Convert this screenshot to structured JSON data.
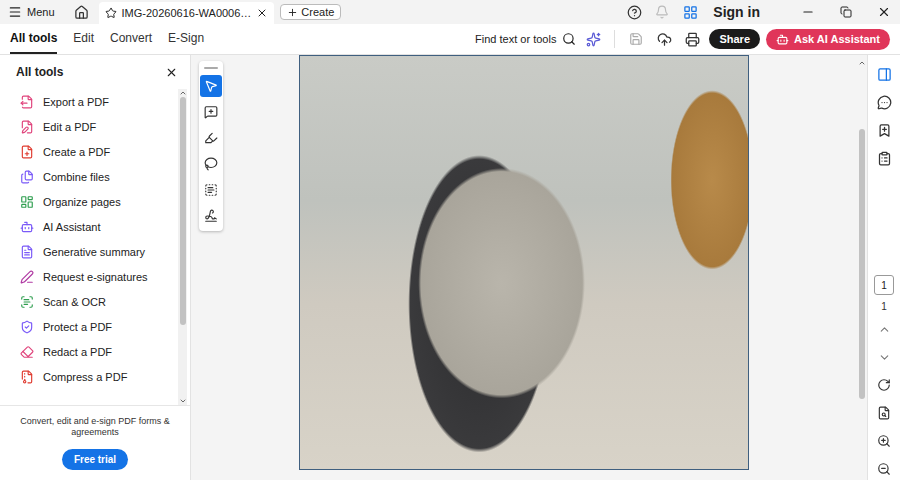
{
  "window": {
    "tab_title": "IMG-20260616-WA0006…",
    "menu": "Menu",
    "create": "Create",
    "sign_in": "Sign in"
  },
  "nav": {
    "tabs": [
      {
        "label": "All tools",
        "selected": true
      },
      {
        "label": "Edit",
        "selected": false
      },
      {
        "label": "Convert",
        "selected": false
      },
      {
        "label": "E-Sign",
        "selected": false
      }
    ],
    "search": "Find text or tools",
    "share": "Share",
    "ai_button": "Ask AI Assistant"
  },
  "sidebar": {
    "title": "All tools",
    "items": [
      {
        "label": "Export a PDF",
        "color": "#e0447c"
      },
      {
        "label": "Edit a PDF",
        "color": "#e0447c"
      },
      {
        "label": "Create a PDF",
        "color": "#e03c31"
      },
      {
        "label": "Combine files",
        "color": "#7a5af8"
      },
      {
        "label": "Organize pages",
        "color": "#2e9e4f"
      },
      {
        "label": "AI Assistant",
        "color": "#7a5af8"
      },
      {
        "label": "Generative summary",
        "color": "#7a5af8"
      },
      {
        "label": "Request e-signatures",
        "color": "#b03aa3"
      },
      {
        "label": "Scan & OCR",
        "color": "#2e9e4f"
      },
      {
        "label": "Protect a PDF",
        "color": "#7a5af8"
      },
      {
        "label": "Redact a PDF",
        "color": "#e0447c"
      },
      {
        "label": "Compress a PDF",
        "color": "#e03c31"
      }
    ],
    "promo": "Convert, edit and e-sign PDF forms & agreements",
    "cta": "Free trial"
  },
  "tool_strip": [
    {
      "selected": true
    },
    {
      "selected": false
    },
    {
      "selected": false
    },
    {
      "selected": false
    },
    {
      "selected": false
    },
    {
      "selected": false
    }
  ],
  "page_nav": {
    "current": "1",
    "total": "1"
  }
}
